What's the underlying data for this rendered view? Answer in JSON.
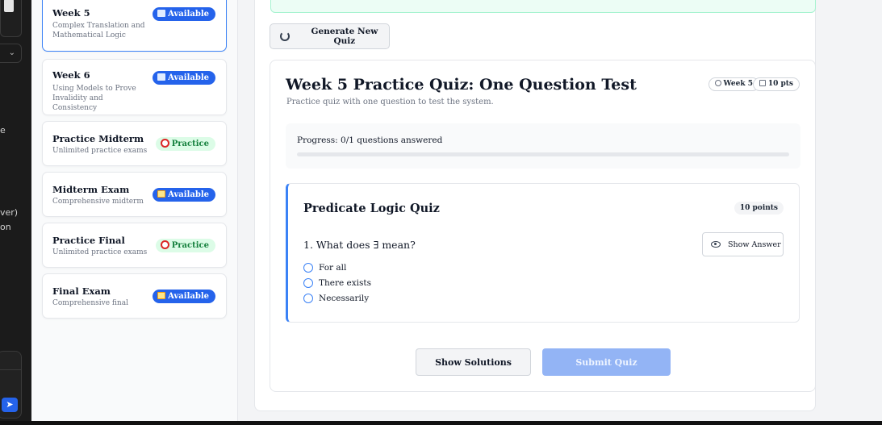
{
  "chat_sidebar": {
    "fragments": [
      "e",
      "ver)",
      "on"
    ],
    "send_icon": "send-icon"
  },
  "weeks": [
    {
      "title": "Week 5",
      "subtitle": "Complex Translation and Mathematical Logic",
      "badge": "Available",
      "badge_type": "available",
      "icon": "book-icon"
    },
    {
      "title": "Week 6",
      "subtitle": "Using Models to Prove Invalidity and Consistency",
      "badge": "Available",
      "badge_type": "available",
      "icon": "book-icon"
    },
    {
      "title": "Practice Midterm",
      "subtitle": "Unlimited practice exams",
      "badge": "Practice",
      "badge_type": "practice",
      "icon": "target-icon"
    },
    {
      "title": "Midterm Exam",
      "subtitle": "Comprehensive midterm",
      "badge": "Available",
      "badge_type": "available",
      "icon": "memo-icon"
    },
    {
      "title": "Practice Final",
      "subtitle": "Unlimited practice exams",
      "badge": "Practice",
      "badge_type": "practice",
      "icon": "target-icon"
    },
    {
      "title": "Final Exam",
      "subtitle": "Comprehensive final",
      "badge": "Available",
      "badge_type": "available",
      "icon": "memo-icon"
    }
  ],
  "toolbar": {
    "generate_label": "Generate New Quiz"
  },
  "quiz": {
    "title": "Week 5 Practice Quiz: One Question Test",
    "description": "Practice quiz with one question to test the system.",
    "week_pill": "Week 5",
    "points_pill": "10 pts",
    "progress_text": "Progress: 0/1 questions answered",
    "progress_fraction": 0,
    "section_title": "Predicate Logic Quiz",
    "section_points": "10 points",
    "question": "1. What does ∃ mean?",
    "show_answer_label": "Show Answer",
    "options": [
      "For all",
      "There exists",
      "Necessarily"
    ],
    "show_solutions_label": "Show Solutions",
    "submit_label": "Submit Quiz"
  },
  "colors": {
    "accent": "#2563eb",
    "practice_bg": "#dcfce7",
    "practice_fg": "#15803d",
    "submit_disabled": "#93b4f5"
  }
}
